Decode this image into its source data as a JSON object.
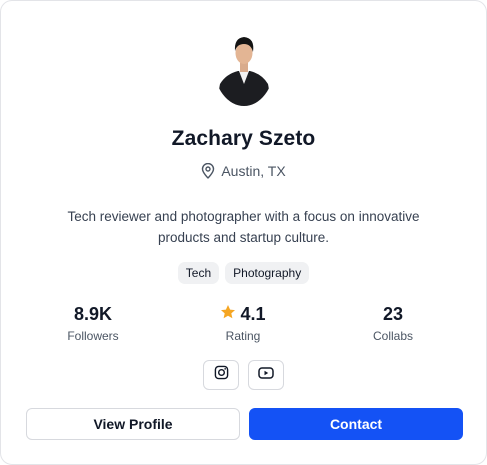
{
  "profile": {
    "name": "Zachary Szeto",
    "location": "Austin, TX",
    "bio": "Tech reviewer and photographer with a focus on innovative products and startup culture."
  },
  "tags": [
    "Tech",
    "Photography"
  ],
  "stats": {
    "followers": {
      "value": "8.9K",
      "label": "Followers"
    },
    "rating": {
      "value": "4.1",
      "label": "Rating"
    },
    "collabs": {
      "value": "23",
      "label": "Collabs"
    }
  },
  "socials": {
    "instagram_icon": "instagram-icon",
    "youtube_icon": "youtube-icon"
  },
  "actions": {
    "view_profile_label": "View Profile",
    "contact_label": "Contact"
  },
  "colors": {
    "primary": "#1452f5",
    "star": "#f5a623",
    "border": "#e3e4e8",
    "tag_bg": "#f0f1f3"
  }
}
